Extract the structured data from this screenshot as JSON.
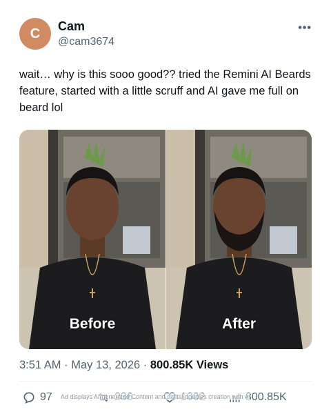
{
  "author": {
    "avatar_letter": "C",
    "name": "Cam",
    "handle": "@cam3674",
    "more_icon": "more-horizontal-icon"
  },
  "post": {
    "text": "wait… why is this sooo good?? tried the Remini AI Beards feature, started with a little scruff and AI gave me full on beard lol"
  },
  "media": {
    "before_label": "Before",
    "after_label": "After"
  },
  "meta": {
    "time": "3:51 AM",
    "sep1": " · ",
    "date": "May 13, 2026",
    "sep2": " · ",
    "views_count": "800.85K",
    "views_label": " Views"
  },
  "actions": {
    "replies": "97",
    "reposts": "236",
    "likes": "1002",
    "views": "800.85K",
    "ad_notice": "Ad displays AI-generated Content and digital doubles creation with AI"
  },
  "colors": {
    "avatar": "#d08b63",
    "text_primary": "#0f1419",
    "text_secondary": "#536471"
  }
}
